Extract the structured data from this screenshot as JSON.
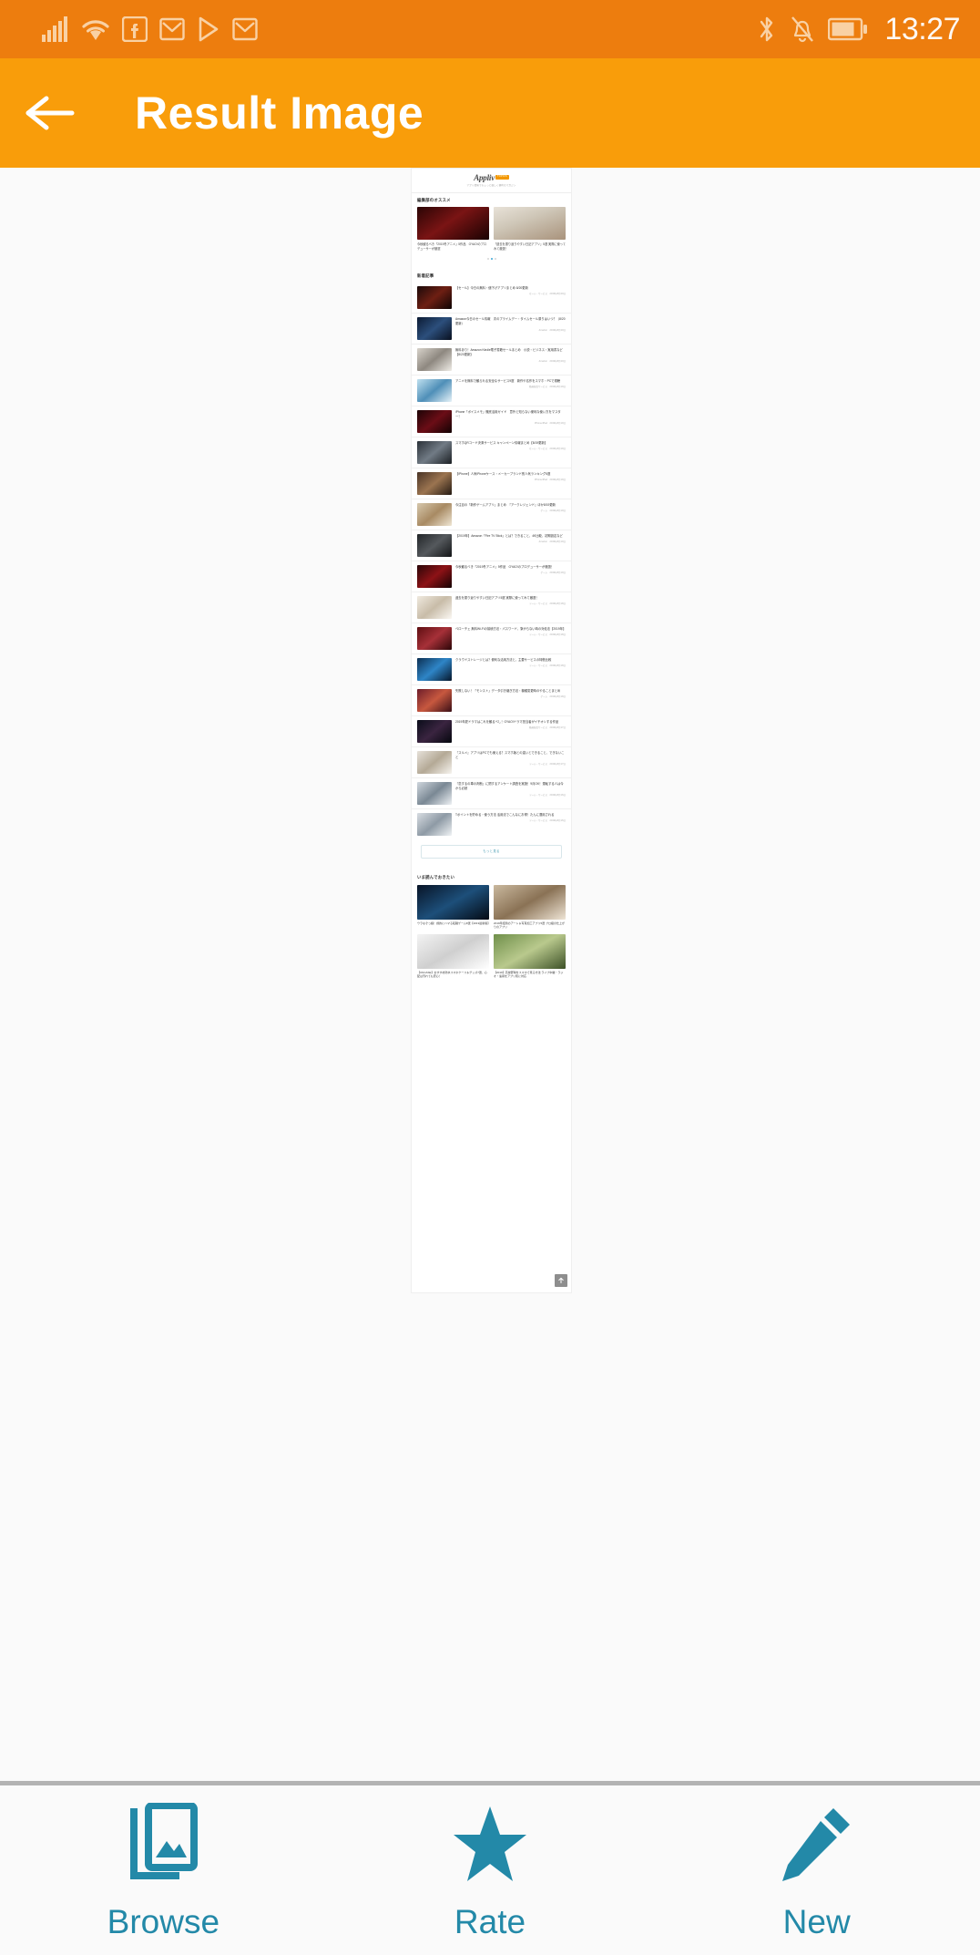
{
  "statusbar": {
    "time": "13:27",
    "left_icons": [
      "signal-icon",
      "wifi-icon",
      "facebook-icon",
      "gmail-icon",
      "play-store-icon",
      "gmail-icon"
    ],
    "right_icons": [
      "bluetooth-icon",
      "notifications-muted-icon",
      "battery-icon"
    ],
    "bg_color": "#ED7D0E"
  },
  "appbar": {
    "title": "Result Image",
    "back_icon": "back-arrow-icon",
    "bg_color": "#F99D0A",
    "text_color": "#FFFFFF"
  },
  "preview": {
    "site": {
      "logo": "Appliv",
      "logo_badge": "TOPICS",
      "tagline": "アプリ情報でちょっと楽しく便利なマガジン"
    },
    "editor_picks": {
      "title": "編集部のオススメ",
      "cards": [
        {
          "text": "今秋観るべき「2019冬アニメ」5作品　GYAO!のプロデューサーが厳選"
        },
        {
          "text": "「過去を振り返りやすい日記アプリ」5選 実際に使ってみて厳選！"
        }
      ],
      "dots": 3,
      "active_dot": 1
    },
    "new_section": {
      "title": "新着記事",
      "articles": [
        {
          "title": "【セール】今日の無料・値下げアプリまとめ 8/20更新",
          "meta": "セール・サービス　2019年8月20日"
        },
        {
          "title": "Amazon今日のセール情報　次のプライムデー・タイムセール祭りはいつ？（8/20更新）",
          "meta": "Amazon　2019年8月20日"
        },
        {
          "title": "無料あり！Amazon Kindle電子書籍セールまとめ　小説・ビジネス・実用書など【8/20更新】",
          "meta": "Amazon　2019年8月20日"
        },
        {
          "title": "アニメを無料で観られる安全なサービス9選　新作や名作をスマホ・PCで視聴",
          "meta": "動画配信サービス　2019年8月19日"
        },
        {
          "title": "iPhone「ボイスメモ」徹底活用ガイド　意外と知らない便利な使い方をマスター！",
          "meta": "iPhone/iPad　2019年8月19日"
        },
        {
          "title": "スマホQRコード決済サービス キャンペーン情報まとめ【8/19更新】",
          "meta": "セール・サービス　2019年8月19日"
        },
        {
          "title": "【iPhone】人気iPhoneケース・メーカーブランド別人気ランキング5選",
          "meta": "iPhone/iPad　2019年8月19日"
        },
        {
          "title": "今注目の「新作ゲームアプリ」まとめ　『アークレジェンド』ほか8/19更新",
          "meta": "ゲーム　2019年8月19日"
        },
        {
          "title": "【2019年】Amazon「Fire TV Stick」とは？できること、4K比較、初期設定など",
          "meta": "Amazon　2019年8月19日"
        },
        {
          "title": "今秋観るべき「2019冬アニメ」5作品　GYAO!のプロデューサーが厳選！",
          "meta": "ゲーム　2019年8月19日"
        },
        {
          "title": "過去を振り返りやすい日記アプリ5選 実際に使ってみて厳選！",
          "meta": "ツール・サービス　2019年8月18日"
        },
        {
          "title": "ベローチェ 無料Wi-Fiの接続方法・パスワード、繋がらない時の対処法【2019年】",
          "meta": "ツール・サービス　2019年8月18日"
        },
        {
          "title": "クラウドストレージとは？便利な活用方法と、主要サービスの特徴比較",
          "meta": "ツール・サービス　2019年8月18日"
        },
        {
          "title": "失敗しない！「モンスト」データ引き継ぎ方法・機種変更時のやることまとめ",
          "meta": "ゲーム　2019年8月18日"
        },
        {
          "title": "2019年夏ドラマはこれを観るべし！GYAO!ドラマ担当者がイチオシする作品",
          "meta": "動画配信サービス　2019年8月17日"
        },
        {
          "title": "『スルメ』アプリはPCでも使える？スマホ版との違いとできること、できないこと",
          "meta": "ツール・サービス　2019年8月17日"
        },
        {
          "title": "『恋するの車の判断』に関するアンケート調査を実施！9月OK！運転する人は今から必読",
          "meta": "ツール・サービス　2019年8月16日"
        },
        {
          "title": "Tポイントを貯める・使う方法 活用法でこんなにお得！たんに運用される",
          "meta": "ツール・サービス　2019年8月16日"
        }
      ],
      "more_button": "もっと見る"
    },
    "read_now": {
      "title": "いま読んでおきたい",
      "cards": [
        {
          "text": "ウラなぞっ娘！劇的にハマる転職ゲーム8選【2019最新版】"
        },
        {
          "text": "2019年話題のアート＆写真加工アプリ5選 プロ級の仕上がりのアプリ"
        },
        {
          "text": "【UNCASE】おすすめ防水スマホケース＆グッズ7選、心配は汚れても安心！"
        },
        {
          "text": "【2019】高校野球をスマホで見る方法 ライブ中継・ラジオ・速報をアプリ別に対応"
        }
      ]
    },
    "scroll_top_icon": "scroll-to-top-icon"
  },
  "bottomnav": {
    "accent_color": "#2389A8",
    "items": [
      {
        "label": "Browse",
        "icon": "gallery-icon"
      },
      {
        "label": "Rate",
        "icon": "star-icon"
      },
      {
        "label": "New",
        "icon": "pencil-icon"
      }
    ]
  }
}
